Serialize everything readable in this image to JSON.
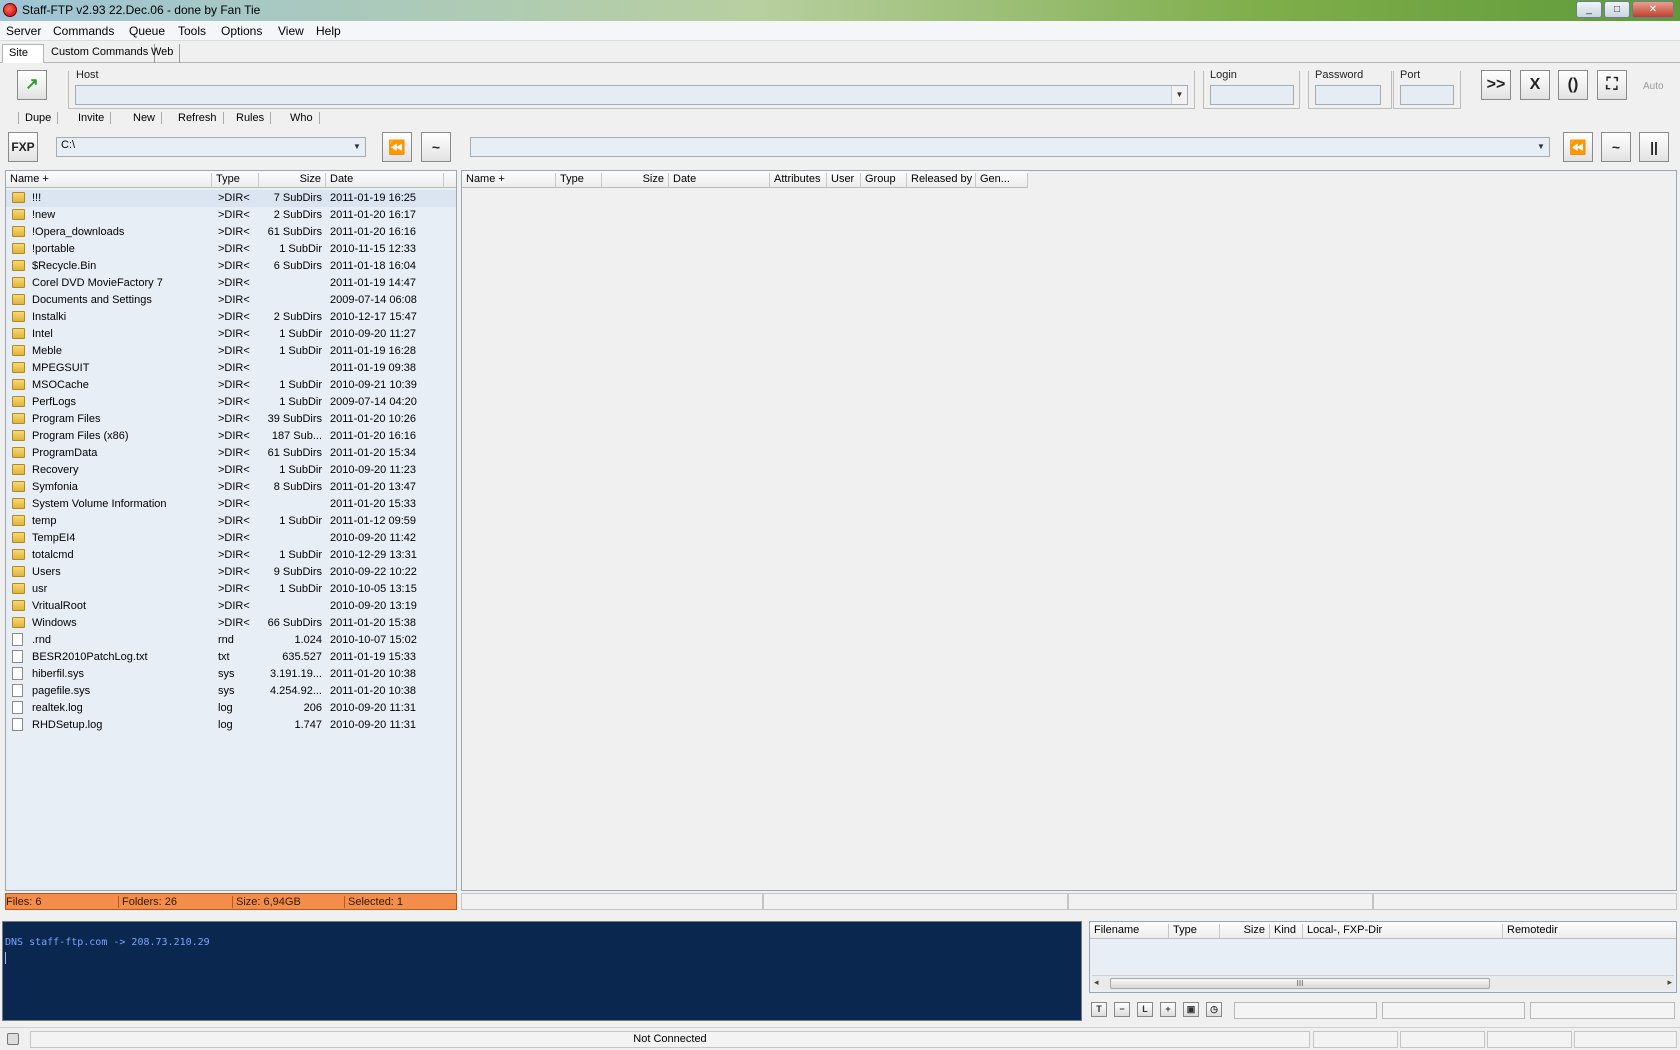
{
  "window": {
    "title": "Staff-FTP v2.93 22.Dec.06 - done by Fan Tie",
    "controls": [
      "_",
      "□",
      "✕"
    ]
  },
  "menu": [
    "Server",
    "Commands",
    "Queue",
    "Tools",
    "Options",
    "View",
    "Help"
  ],
  "tabs": [
    "Site",
    "Custom Commands",
    "Web"
  ],
  "connection": {
    "host_label": "Host",
    "host_value": "",
    "login_label": "Login",
    "password_label": "Password",
    "port_label": "Port",
    "auto_label": "Auto"
  },
  "commands": [
    "Dupe",
    "Invite",
    "New",
    "Refresh",
    "Rules",
    "Who"
  ],
  "local": {
    "fxp_label": "FXP",
    "path": "C:\\",
    "columns": [
      "Name +",
      "Type",
      "Size",
      "Date"
    ],
    "files": [
      {
        "name": "!!!",
        "type": ">DIR<",
        "size": "7 SubDirs",
        "date": "2011-01-19 16:25",
        "kind": "folder"
      },
      {
        "name": "!new",
        "type": ">DIR<",
        "size": "2 SubDirs",
        "date": "2011-01-20 16:17",
        "kind": "folder"
      },
      {
        "name": "!Opera_downloads",
        "type": ">DIR<",
        "size": "61 SubDirs",
        "date": "2011-01-20 16:16",
        "kind": "folder"
      },
      {
        "name": "!portable",
        "type": ">DIR<",
        "size": "1 SubDir",
        "date": "2010-11-15 12:33",
        "kind": "folder"
      },
      {
        "name": "$Recycle.Bin",
        "type": ">DIR<",
        "size": "6 SubDirs",
        "date": "2011-01-18 16:04",
        "kind": "folder"
      },
      {
        "name": "Corel DVD MovieFactory 7",
        "type": ">DIR<",
        "size": "",
        "date": "2011-01-19 14:47",
        "kind": "folder"
      },
      {
        "name": "Documents and Settings",
        "type": ">DIR<",
        "size": "",
        "date": "2009-07-14 06:08",
        "kind": "folder"
      },
      {
        "name": "Instalki",
        "type": ">DIR<",
        "size": "2 SubDirs",
        "date": "2010-12-17 15:47",
        "kind": "folder"
      },
      {
        "name": "Intel",
        "type": ">DIR<",
        "size": "1 SubDir",
        "date": "2010-09-20 11:27",
        "kind": "folder"
      },
      {
        "name": "Meble",
        "type": ">DIR<",
        "size": "1 SubDir",
        "date": "2011-01-19 16:28",
        "kind": "folder"
      },
      {
        "name": "MPEGSUIT",
        "type": ">DIR<",
        "size": "",
        "date": "2011-01-19 09:38",
        "kind": "folder"
      },
      {
        "name": "MSOCache",
        "type": ">DIR<",
        "size": "1 SubDir",
        "date": "2010-09-21 10:39",
        "kind": "folder"
      },
      {
        "name": "PerfLogs",
        "type": ">DIR<",
        "size": "1 SubDir",
        "date": "2009-07-14 04:20",
        "kind": "folder"
      },
      {
        "name": "Program Files",
        "type": ">DIR<",
        "size": "39 SubDirs",
        "date": "2011-01-20 10:26",
        "kind": "folder"
      },
      {
        "name": "Program Files (x86)",
        "type": ">DIR<",
        "size": "187 Sub...",
        "date": "2011-01-20 16:16",
        "kind": "folder"
      },
      {
        "name": "ProgramData",
        "type": ">DIR<",
        "size": "61 SubDirs",
        "date": "2011-01-20 15:34",
        "kind": "folder"
      },
      {
        "name": "Recovery",
        "type": ">DIR<",
        "size": "1 SubDir",
        "date": "2010-09-20 11:23",
        "kind": "folder"
      },
      {
        "name": "Symfonia",
        "type": ">DIR<",
        "size": "8 SubDirs",
        "date": "2011-01-20 13:47",
        "kind": "folder"
      },
      {
        "name": "System Volume Information",
        "type": ">DIR<",
        "size": "",
        "date": "2011-01-20 15:33",
        "kind": "folder"
      },
      {
        "name": "temp",
        "type": ">DIR<",
        "size": "1 SubDir",
        "date": "2011-01-12 09:59",
        "kind": "folder"
      },
      {
        "name": "TempEI4",
        "type": ">DIR<",
        "size": "",
        "date": "2010-09-20 11:42",
        "kind": "folder"
      },
      {
        "name": "totalcmd",
        "type": ">DIR<",
        "size": "1 SubDir",
        "date": "2010-12-29 13:31",
        "kind": "folder"
      },
      {
        "name": "Users",
        "type": ">DIR<",
        "size": "9 SubDirs",
        "date": "2010-09-22 10:22",
        "kind": "folder"
      },
      {
        "name": "usr",
        "type": ">DIR<",
        "size": "1 SubDir",
        "date": "2010-10-05 13:15",
        "kind": "folder"
      },
      {
        "name": "VritualRoot",
        "type": ">DIR<",
        "size": "",
        "date": "2010-09-20 13:19",
        "kind": "folder"
      },
      {
        "name": "Windows",
        "type": ">DIR<",
        "size": "66 SubDirs",
        "date": "2011-01-20 15:38",
        "kind": "folder"
      },
      {
        "name": ".rnd",
        "type": "rnd",
        "size": "1.024",
        "date": "2010-10-07 15:02",
        "kind": "file"
      },
      {
        "name": "BESR2010PatchLog.txt",
        "type": "txt",
        "size": "635.527",
        "date": "2011-01-19 15:33",
        "kind": "file"
      },
      {
        "name": "hiberfil.sys",
        "type": "sys",
        "size": "3.191.19...",
        "date": "2011-01-20 10:38",
        "kind": "file"
      },
      {
        "name": "pagefile.sys",
        "type": "sys",
        "size": "4.254.92...",
        "date": "2011-01-20 10:38",
        "kind": "file"
      },
      {
        "name": "realtek.log",
        "type": "log",
        "size": "206",
        "date": "2010-09-20 11:31",
        "kind": "file"
      },
      {
        "name": "RHDSetup.log",
        "type": "log",
        "size": "1.747",
        "date": "2010-09-20 11:31",
        "kind": "file"
      }
    ],
    "status": {
      "files": "Files: 6",
      "folders": "Folders: 26",
      "size": "Size: 6,94GB",
      "selected": "Selected: 1"
    }
  },
  "remote": {
    "path": "",
    "columns": [
      "Name +",
      "Type",
      "Size",
      "Date",
      "Attributes",
      "User",
      "Group",
      "Released by",
      "Gen..."
    ]
  },
  "log": {
    "lines": [
      "DNS staff-ftp.com -> 208.73.210.29"
    ]
  },
  "queue": {
    "columns": [
      "Filename",
      "Type",
      "Size",
      "Kind",
      "Local-, FXP-Dir",
      "Remotedir"
    ],
    "scroll_thumb": "III"
  },
  "statusbar": {
    "connection_state": "Not Connected"
  },
  "colors": {
    "local_pane_bg": "#e8eef6",
    "status_orange": "#f58d4a",
    "log_bg": "#0a2750",
    "log_text": "#7aa4ff"
  }
}
